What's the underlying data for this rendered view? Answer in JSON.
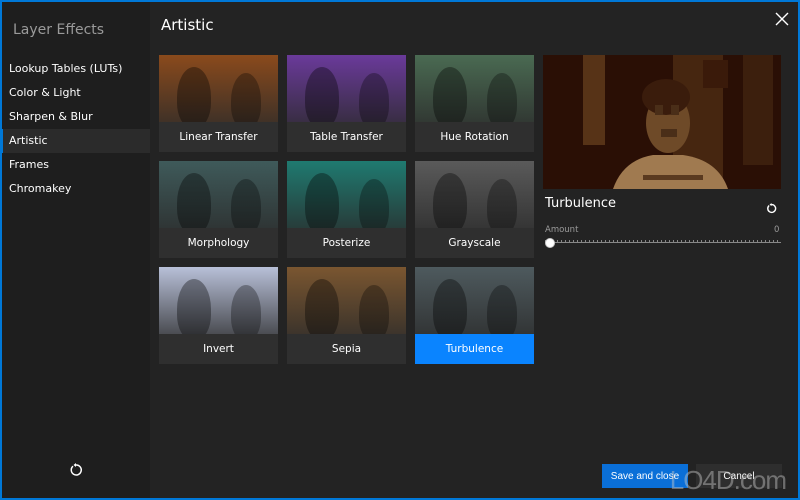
{
  "sidebar": {
    "title": "Layer Effects",
    "items": [
      {
        "label": "Lookup Tables (LUTs)",
        "active": false
      },
      {
        "label": "Color & Light",
        "active": false
      },
      {
        "label": "Sharpen & Blur",
        "active": false
      },
      {
        "label": "Artistic",
        "active": true
      },
      {
        "label": "Frames",
        "active": false
      },
      {
        "label": "Chromakey",
        "active": false
      }
    ],
    "reset_icon": "reset-icon"
  },
  "main": {
    "title": "Artistic",
    "close_icon": "close-icon",
    "effects": [
      {
        "label": "Linear Transfer",
        "tint": "#8a4a1c",
        "selected": false
      },
      {
        "label": "Table Transfer",
        "tint": "#6a3a9a",
        "selected": false
      },
      {
        "label": "Hue Rotation",
        "tint": "#4a6a52",
        "selected": false
      },
      {
        "label": "Morphology",
        "tint": "#3f5a5a",
        "selected": false
      },
      {
        "label": "Posterize",
        "tint": "#1f7a70",
        "selected": false
      },
      {
        "label": "Grayscale",
        "tint": "#5a5a5a",
        "selected": false
      },
      {
        "label": "Invert",
        "tint": "#b8c0d8",
        "selected": false
      },
      {
        "label": "Sepia",
        "tint": "#7a5630",
        "selected": false
      },
      {
        "label": "Turbulence",
        "tint": "#4e5a5e",
        "selected": true
      }
    ]
  },
  "panel": {
    "effect_name": "Turbulence",
    "amount_label": "Amount",
    "amount_value": "0",
    "amount_fraction": 0,
    "reset_icon": "reset-icon"
  },
  "footer": {
    "save_label": "Save and close",
    "cancel_label": "Cancel"
  },
  "watermark": "LO4D.com",
  "colors": {
    "accent": "#0a84ff",
    "background": "#1e1e1e",
    "panel": "#232323"
  }
}
